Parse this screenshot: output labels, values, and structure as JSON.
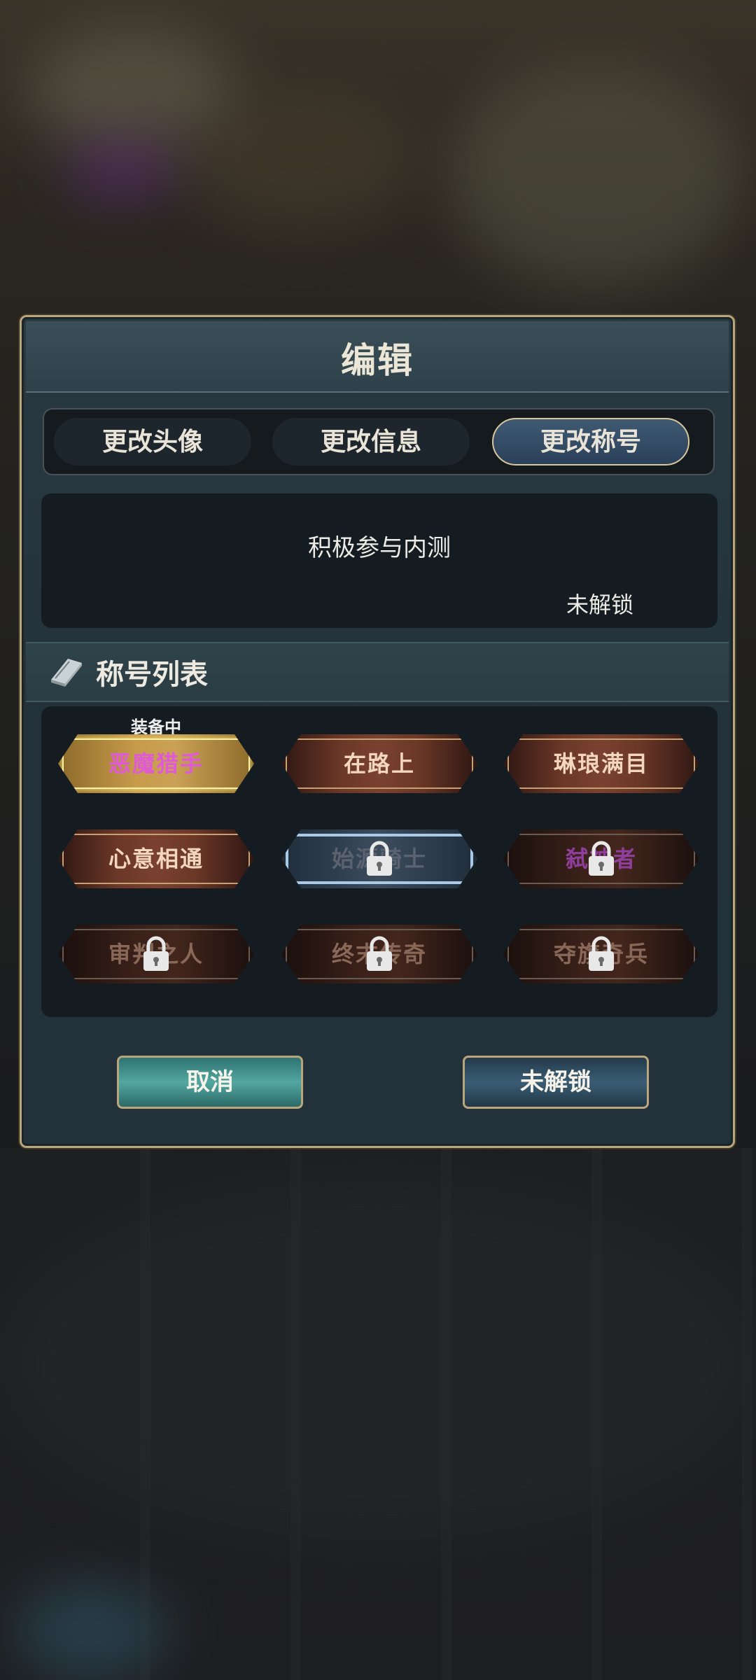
{
  "dialog": {
    "title": "编辑"
  },
  "tabs": [
    {
      "label": "更改头像",
      "active": false
    },
    {
      "label": "更改信息",
      "active": false
    },
    {
      "label": "更改称号",
      "active": true
    }
  ],
  "selected_title": {
    "name": "积极参与内测",
    "status": "未解锁"
  },
  "section": {
    "title": "称号列表",
    "icon": "book-icon"
  },
  "equipped_tag": "装备中",
  "titles": [
    {
      "label": "恶魔猎手",
      "state": "equipped"
    },
    {
      "label": "在路上",
      "state": "unlocked"
    },
    {
      "label": "琳琅满目",
      "state": "unlocked"
    },
    {
      "label": "心意相通",
      "state": "unlocked"
    },
    {
      "label": "始源骑士",
      "state": "locked-selected"
    },
    {
      "label": "弑神者",
      "state": "locked"
    },
    {
      "label": "审判之人",
      "state": "locked"
    },
    {
      "label": "终末传奇",
      "state": "locked"
    },
    {
      "label": "夺旗奇兵",
      "state": "locked"
    }
  ],
  "buttons": {
    "cancel": "取消",
    "confirm": "未解锁"
  },
  "colors": {
    "frame_gold": "#b9a67c",
    "cancel_teal": "#53a7a1",
    "confirm_blue": "#3a5d74",
    "equipped_text": "#e05ad8"
  }
}
